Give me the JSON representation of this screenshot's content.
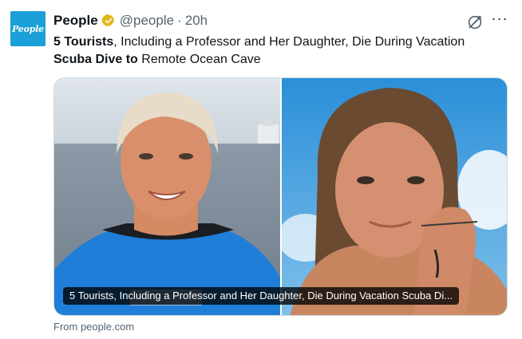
{
  "tweet": {
    "avatar_text": "People",
    "author_name": "People",
    "handle": "@people",
    "separator": "·",
    "time": "20h",
    "more_label": "···",
    "text_part1_bold": "5 Tourists",
    "text_part2": ", Including a Professor and Her Daughter, Die During Vacation",
    "text_part3_bold": "Scuba Dive to",
    "text_part4": " Remote Ocean Cave",
    "card_caption": "5 Tourists, Including a Professor and Her Daughter, Die During Vacation Scuba Di...",
    "source": "From people.com"
  },
  "colors": {
    "avatar_bg": "#1a9fd6",
    "verified_badge": "#e2b719",
    "secondary_text": "#536471"
  },
  "icons": [
    "verified-badge-icon",
    "grok-icon",
    "more-options-icon"
  ]
}
